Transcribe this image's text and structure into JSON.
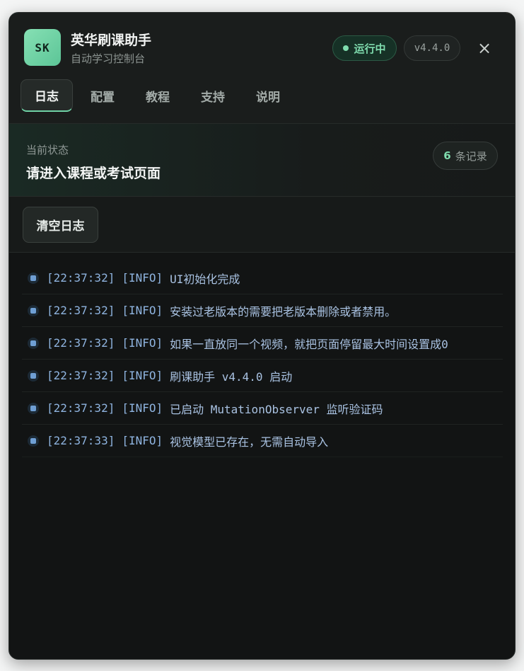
{
  "app": {
    "logo_text": "SK",
    "title": "英华刷课助手",
    "subtitle": "自动学习控制台",
    "status": "运行中",
    "version": "v4.4.0",
    "close_symbol": "×"
  },
  "tabs": [
    {
      "label": "日志",
      "active": true
    },
    {
      "label": "配置",
      "active": false
    },
    {
      "label": "教程",
      "active": false
    },
    {
      "label": "支持",
      "active": false
    },
    {
      "label": "说明",
      "active": false
    }
  ],
  "status_section": {
    "label": "当前状态",
    "text": "请进入课程或考试页面",
    "count": "6",
    "count_label": "条记录"
  },
  "actions": {
    "clear_label": "清空日志"
  },
  "logs": [
    {
      "time": "[22:37:32]",
      "level": "[INFO]",
      "message": "UI初始化完成"
    },
    {
      "time": "[22:37:32]",
      "level": "[INFO]",
      "message": "安装过老版本的需要把老版本删除或者禁用。"
    },
    {
      "time": "[22:37:32]",
      "level": "[INFO]",
      "message": "如果一直放同一个视频，就把页面停留最大时间设置成0"
    },
    {
      "time": "[22:37:32]",
      "level": "[INFO]",
      "message": "刷课助手 v4.4.0 启动"
    },
    {
      "time": "[22:37:32]",
      "level": "[INFO]",
      "message": "已启动 MutationObserver 监听验证码"
    },
    {
      "time": "[22:37:33]",
      "level": "[INFO]",
      "message": "视觉模型已存在，无需自动导入"
    }
  ],
  "colors": {
    "accent": "#7fdcae",
    "panel_bg": "#121414",
    "log_text": "#8fb4e0"
  },
  "icons": {
    "close": "close-icon",
    "status": "status-dot-icon",
    "log_bullet": "log-bullet-icon"
  }
}
